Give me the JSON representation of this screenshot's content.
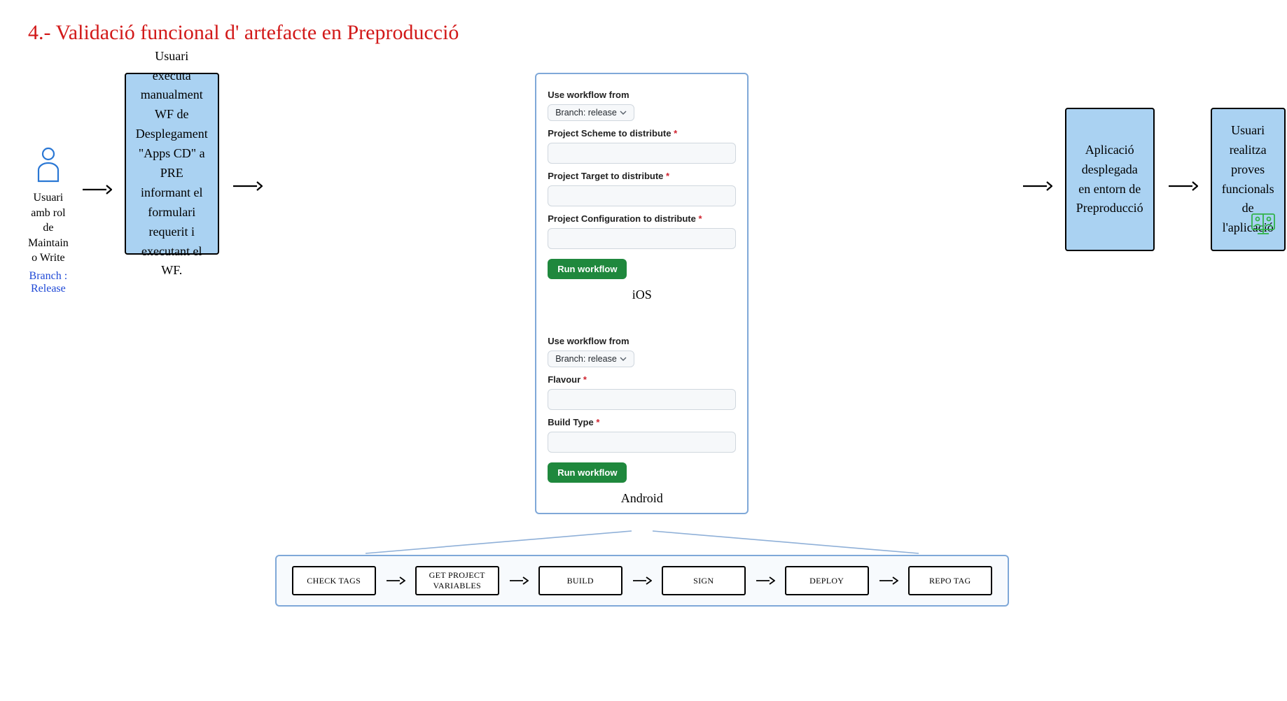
{
  "title": "4.- Validació funcional d' artefacte en Preproducció",
  "user": {
    "role_line1": "Usuari amb rol de",
    "role_line2": "Maintain o Write",
    "branch": "Branch : Release"
  },
  "step1": "Usuari executa manualment WF de Desplegament \"Apps CD\" a PRE informant el formulari requerit i executant el WF.",
  "forms": {
    "ios": {
      "workflow_from_label": "Use workflow from",
      "branch_text": "Branch: release",
      "field1": "Project Scheme to distribute",
      "field2": "Project Target to distribute",
      "field3": "Project Configuration to distribute",
      "run": "Run workflow",
      "platform": "iOS"
    },
    "android": {
      "workflow_from_label": "Use workflow from",
      "branch_text": "Branch: release",
      "field1": "Flavour",
      "field2": "Build Type",
      "run": "Run workflow",
      "platform": "Android"
    }
  },
  "step3": "Aplicació desplegada en entorn de Preproducció",
  "step4": "Usuari realitza proves funcionals de l'aplicació",
  "pipeline": {
    "s1": "CHECK TAGS",
    "s2": "GET PROJECT VARIABLES",
    "s3": "BUILD",
    "s4": "SIGN",
    "s5": "DEPLOY",
    "s6": "REPO TAG"
  }
}
